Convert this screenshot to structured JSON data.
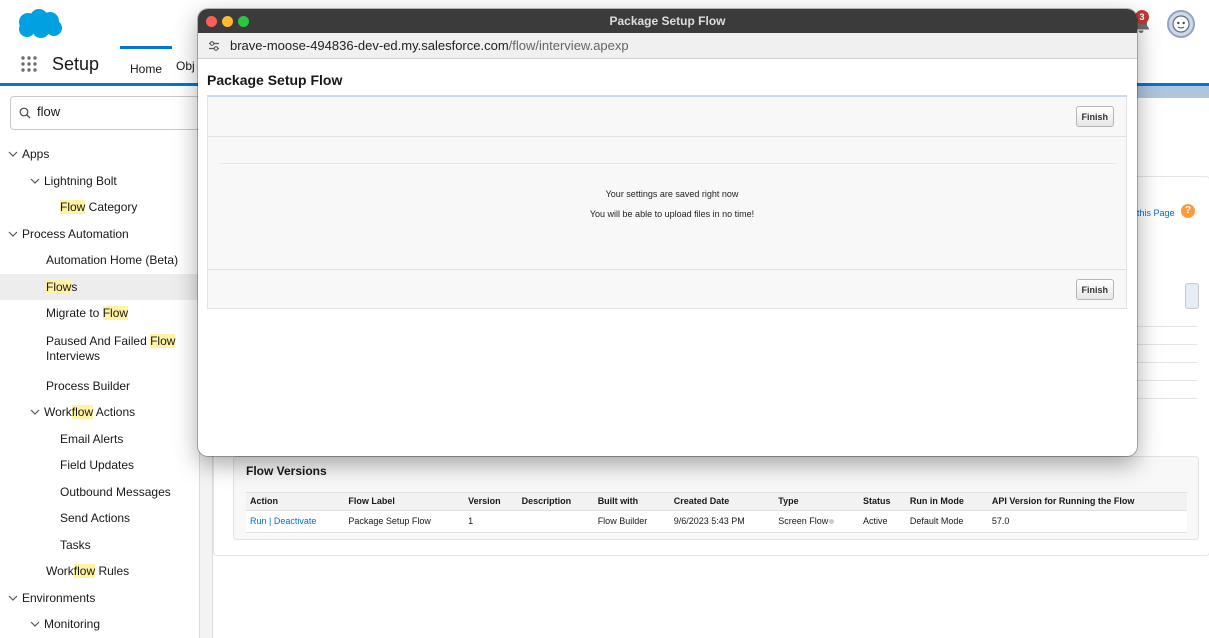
{
  "header": {
    "notifications_count": "3"
  },
  "nav": {
    "app_name": "Setup",
    "tabs": [
      "Home",
      "Obj"
    ]
  },
  "sidebar": {
    "search_value": "flow",
    "items": [
      {
        "label": "Apps",
        "level": 0,
        "chevron": true
      },
      {
        "label": "Lightning Bolt",
        "level": 1,
        "chevron": true
      },
      {
        "label": "Flow Category",
        "level": 2,
        "chevron": false
      },
      {
        "label": "Process Automation",
        "level": 0,
        "chevron": true
      },
      {
        "label": "Automation Home (Beta)",
        "level": 1,
        "chevron": false
      },
      {
        "label": "Flows",
        "level": 1,
        "chevron": false,
        "selected": true
      },
      {
        "label": "Migrate to Flow",
        "level": 1,
        "chevron": false
      },
      {
        "label": "Paused And Failed Flow Interviews",
        "level": 1,
        "chevron": false
      },
      {
        "label": "Process Builder",
        "level": 1,
        "chevron": false
      },
      {
        "label": "Workflow Actions",
        "level": 1,
        "chevron": true
      },
      {
        "label": "Email Alerts",
        "level": 2,
        "chevron": false
      },
      {
        "label": "Field Updates",
        "level": 2,
        "chevron": false
      },
      {
        "label": "Outbound Messages",
        "level": 2,
        "chevron": false
      },
      {
        "label": "Send Actions",
        "level": 2,
        "chevron": false
      },
      {
        "label": "Tasks",
        "level": 2,
        "chevron": false
      },
      {
        "label": "Workflow Rules",
        "level": 1,
        "chevron": false
      },
      {
        "label": "Environments",
        "level": 0,
        "chevron": true
      },
      {
        "label": "Monitoring",
        "level": 1,
        "chevron": true
      }
    ]
  },
  "main": {
    "help_link": "this Page",
    "flow_versions": {
      "title": "Flow Versions",
      "columns": [
        "Action",
        "Flow Label",
        "Version",
        "Description",
        "Built with",
        "Created Date",
        "Type",
        "Status",
        "Run in Mode",
        "API Version for Running the Flow"
      ],
      "rows": [
        {
          "action_run": "Run",
          "action_sep": " | ",
          "action_deactivate": "Deactivate",
          "flow_label": "Package Setup Flow",
          "version": "1",
          "description": "",
          "built_with": "Flow Builder",
          "created_date": "9/6/2023 5:43 PM",
          "type": "Screen Flow",
          "status": "Active",
          "run_in_mode": "Default Mode",
          "api_version": "57.0"
        }
      ]
    }
  },
  "popup": {
    "window_title": "Package Setup Flow",
    "url_host": "brave-moose-494836-dev-ed.my.salesforce.com",
    "url_path": "/flow/interview.apexp",
    "page_title": "Package Setup Flow",
    "finish_label": "Finish",
    "messages": [
      "Your settings are saved right now",
      "You will be able to upload files in no time!"
    ]
  },
  "colors": {
    "brand_blue": "#0176d3",
    "link_blue": "#0070d2",
    "highlight": "#fff3a3",
    "badge_red": "#c23934",
    "titlebar": "#3b3b3b",
    "close": "#ff5f57",
    "minimize": "#febc2e",
    "maximize": "#28c840"
  }
}
